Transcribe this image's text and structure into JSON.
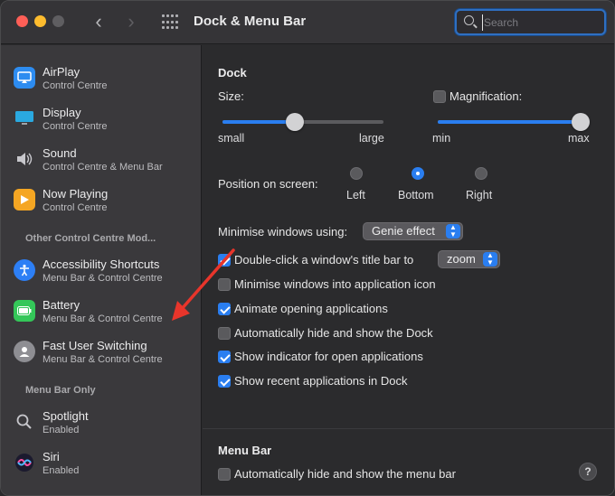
{
  "window": {
    "title": "Dock & Menu Bar",
    "search": {
      "placeholder": "Search",
      "value": ""
    }
  },
  "sidebar": {
    "items": [
      {
        "title": "AirPlay",
        "subtitle": "Control Centre",
        "icon": "airplay-icon",
        "color": "#2d8cf0"
      },
      {
        "title": "Display",
        "subtitle": "Control Centre",
        "icon": "display-icon",
        "color": "#2aa9e0"
      },
      {
        "title": "Sound",
        "subtitle": "Control Centre & Menu Bar",
        "icon": "speaker-icon",
        "color": "#8e8e93"
      },
      {
        "title": "Now Playing",
        "subtitle": "Control Centre",
        "icon": "now-playing-icon",
        "color": "#f5a623"
      }
    ],
    "other_section": "Other Control Centre Mod...",
    "other_items": [
      {
        "title": "Accessibility Shortcuts",
        "subtitle": "Menu Bar & Control Centre",
        "icon": "accessibility-icon",
        "color": "#2d7ff5"
      },
      {
        "title": "Battery",
        "subtitle": "Menu Bar & Control Centre",
        "icon": "battery-icon",
        "color": "#34c759"
      },
      {
        "title": "Fast User Switching",
        "subtitle": "Menu Bar & Control Centre",
        "icon": "user-icon",
        "color": "#8e8e93"
      }
    ],
    "menu_section": "Menu Bar Only",
    "menu_items": [
      {
        "title": "Spotlight",
        "subtitle": "Enabled",
        "icon": "spotlight-icon"
      },
      {
        "title": "Siri",
        "subtitle": "Enabled",
        "icon": "siri-icon"
      }
    ]
  },
  "dock": {
    "heading": "Dock",
    "size_label": "Size:",
    "size_min": "small",
    "size_max": "large",
    "size_level": 0.45,
    "magnification_label": "Magnification:",
    "magnification_checked": false,
    "mag_min": "min",
    "mag_max": "max",
    "mag_level": 1.0,
    "position_label": "Position on screen:",
    "positions": [
      "Left",
      "Bottom",
      "Right"
    ],
    "position_selected": "Bottom",
    "minimise_label": "Minimise windows using:",
    "minimise_value": "Genie effect",
    "doubleclick_label": "Double-click a window's title bar to",
    "doubleclick_value": "zoom",
    "doubleclick_checked": true,
    "options": [
      {
        "label": "Minimise windows into application icon",
        "checked": false
      },
      {
        "label": "Animate opening applications",
        "checked": true
      },
      {
        "label": "Automatically hide and show the Dock",
        "checked": false
      },
      {
        "label": "Show indicator for open applications",
        "checked": true
      },
      {
        "label": "Show recent applications in Dock",
        "checked": true
      }
    ]
  },
  "menubar": {
    "heading": "Menu Bar",
    "autohide_label": "Automatically hide and show the menu bar",
    "autohide_checked": false
  },
  "help_label": "?",
  "colors": {
    "accent": "#2a7ef0",
    "annotation": "#e8352b"
  }
}
